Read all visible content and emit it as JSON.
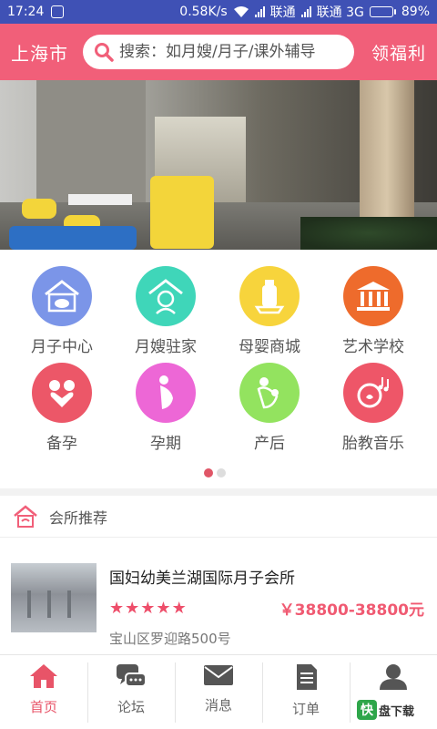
{
  "status_bar": {
    "time": "17:24",
    "speed": "0.58K/s",
    "carrier1": "联通",
    "carrier2": "联通 3G",
    "battery": "89%",
    "battery_level": 0.89
  },
  "header": {
    "city": "上海市",
    "search_placeholder": "搜索：如月嫂/月子/课外辅导",
    "welfare": "领福利"
  },
  "categories": [
    {
      "label": "月子中心",
      "icon": "baby-bed-icon",
      "color": "#7b95e8"
    },
    {
      "label": "月嫂驻家",
      "icon": "nanny-home-icon",
      "color": "#3fd6b9"
    },
    {
      "label": "母婴商城",
      "icon": "bottle-cart-icon",
      "color": "#f7d43c"
    },
    {
      "label": "艺术学校",
      "icon": "school-building-icon",
      "color": "#ee6b2c"
    },
    {
      "label": "备孕",
      "icon": "couple-heart-icon",
      "color": "#ec5768"
    },
    {
      "label": "孕期",
      "icon": "pregnant-icon",
      "color": "#ed67d6"
    },
    {
      "label": "产后",
      "icon": "mother-baby-icon",
      "color": "#93e35f"
    },
    {
      "label": "胎教音乐",
      "icon": "music-heart-icon",
      "color": "#ee5668"
    }
  ],
  "recommend": {
    "title": "会所推荐",
    "items": [
      {
        "name": "国妇幼美兰湖国际月子会所",
        "rating": 5,
        "price": "￥38800-38800元",
        "address": "宝山区罗迎路500号"
      }
    ]
  },
  "tabbar": [
    {
      "label": "首页",
      "icon": "home-icon",
      "active": true
    },
    {
      "label": "论坛",
      "icon": "chat-bubbles-icon",
      "active": false
    },
    {
      "label": "消息",
      "icon": "mail-icon",
      "active": false
    },
    {
      "label": "订单",
      "icon": "order-list-icon",
      "active": false
    },
    {
      "label": "",
      "icon": "person-icon",
      "active": false
    }
  ],
  "watermark": {
    "k": "快",
    "text": "盘下载"
  },
  "colors": {
    "accent": "#f15f79",
    "status_bar": "#3f51b5",
    "price": "#f05a72"
  }
}
